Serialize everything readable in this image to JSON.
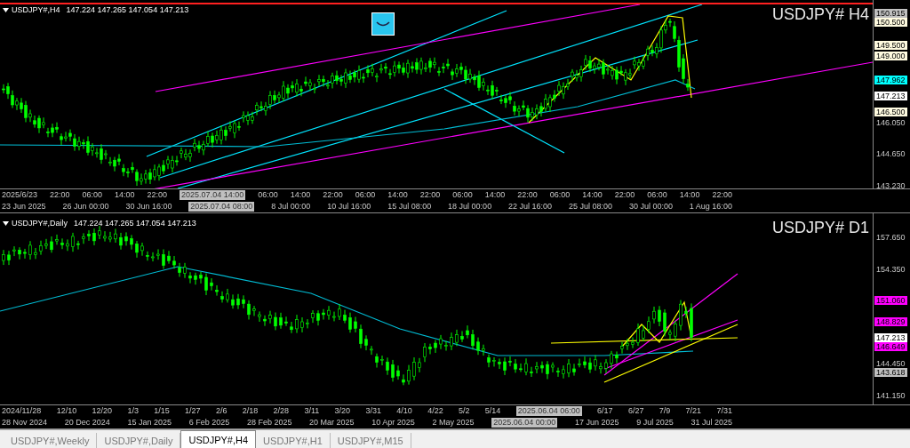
{
  "panes": [
    {
      "symbol": "USDJPY#,H4",
      "ohlc": "147.224 147.265 147.054 147.213",
      "title": "USDJPY# H4",
      "price_axis": [
        {
          "text": "150.915",
          "kind": "tag",
          "color": "#c0c0c0"
        },
        {
          "text": "150.500",
          "kind": "tag",
          "color": "#fffbe0"
        },
        {
          "text": "149.500",
          "kind": "tag",
          "color": "#fffbe0"
        },
        {
          "text": "149.000",
          "kind": "tag",
          "color": "#fffbe0"
        },
        {
          "text": "147.962",
          "kind": "tag",
          "color": "#00ffff"
        },
        {
          "text": "147.213",
          "kind": "tag",
          "color": "#ffffff"
        },
        {
          "text": "146.500",
          "kind": "tag",
          "color": "#fffbe0"
        },
        {
          "text": "146.050",
          "kind": "tick"
        },
        {
          "text": "144.650",
          "kind": "tick"
        },
        {
          "text": "143.230",
          "kind": "tick"
        }
      ],
      "time_row_1": [
        {
          "text": "2025/6/23",
          "kind": "tick"
        },
        {
          "text": "22:00",
          "kind": "tick"
        },
        {
          "text": "06:00",
          "kind": "tick"
        },
        {
          "text": "14:00",
          "kind": "tick"
        },
        {
          "text": "22:00",
          "kind": "tick"
        },
        {
          "text": "2025.07.04 14:00",
          "kind": "crosshair"
        },
        {
          "text": "06:00",
          "kind": "tick"
        },
        {
          "text": "14:00",
          "kind": "tick"
        },
        {
          "text": "22:00",
          "kind": "tick"
        },
        {
          "text": "06:00",
          "kind": "tick"
        },
        {
          "text": "14:00",
          "kind": "tick"
        },
        {
          "text": "22:00",
          "kind": "tick"
        },
        {
          "text": "06:00",
          "kind": "tick"
        },
        {
          "text": "14:00",
          "kind": "tick"
        },
        {
          "text": "22:00",
          "kind": "tick"
        },
        {
          "text": "06:00",
          "kind": "tick"
        },
        {
          "text": "14:00",
          "kind": "tick"
        },
        {
          "text": "22:00",
          "kind": "tick"
        },
        {
          "text": "06:00",
          "kind": "tick"
        },
        {
          "text": "14:00",
          "kind": "tick"
        },
        {
          "text": "22:00",
          "kind": "tick"
        }
      ],
      "time_row_2": [
        {
          "text": "23 Jun 2025",
          "kind": "tick"
        },
        {
          "text": "26 Jun 00:00",
          "kind": "tick"
        },
        {
          "text": "30 Jun 16:00",
          "kind": "tick"
        },
        {
          "text": "2025.07.04 08:00",
          "kind": "crosshair"
        },
        {
          "text": "8 Jul 00:00",
          "kind": "tick"
        },
        {
          "text": "10 Jul 16:00",
          "kind": "tick"
        },
        {
          "text": "15 Jul 08:00",
          "kind": "tick"
        },
        {
          "text": "18 Jul 00:00",
          "kind": "tick"
        },
        {
          "text": "22 Jul 16:00",
          "kind": "tick"
        },
        {
          "text": "25 Jul 08:00",
          "kind": "tick"
        },
        {
          "text": "30 Jul 00:00",
          "kind": "tick"
        },
        {
          "text": "1 Aug 16:00",
          "kind": "tick"
        }
      ]
    },
    {
      "symbol": "USDJPY#,Daily",
      "ohlc": "147.224 147.265 147.054 147.213",
      "title": "USDJPY# D1",
      "price_axis": [
        {
          "text": "157.650",
          "kind": "tick"
        },
        {
          "text": "154.350",
          "kind": "tick"
        },
        {
          "text": "151.060",
          "kind": "tag",
          "color": "#ff00ff"
        },
        {
          "text": "148.829",
          "kind": "tag",
          "color": "#ff00ff"
        },
        {
          "text": "147.213",
          "kind": "tag",
          "color": "#ffffff"
        },
        {
          "text": "146.649",
          "kind": "tag",
          "color": "#ff00ff"
        },
        {
          "text": "144.450",
          "kind": "tick"
        },
        {
          "text": "143.618",
          "kind": "tag",
          "color": "#c0c0c0"
        },
        {
          "text": "141.150",
          "kind": "tick"
        }
      ],
      "time_row_1": [
        {
          "text": "2024/11/28",
          "kind": "tick"
        },
        {
          "text": "12/10",
          "kind": "tick"
        },
        {
          "text": "12/20",
          "kind": "tick"
        },
        {
          "text": "1/3",
          "kind": "tick"
        },
        {
          "text": "1/15",
          "kind": "tick"
        },
        {
          "text": "1/27",
          "kind": "tick"
        },
        {
          "text": "2/6",
          "kind": "tick"
        },
        {
          "text": "2/18",
          "kind": "tick"
        },
        {
          "text": "2/28",
          "kind": "tick"
        },
        {
          "text": "3/11",
          "kind": "tick"
        },
        {
          "text": "3/20",
          "kind": "tick"
        },
        {
          "text": "3/31",
          "kind": "tick"
        },
        {
          "text": "4/10",
          "kind": "tick"
        },
        {
          "text": "4/22",
          "kind": "tick"
        },
        {
          "text": "5/2",
          "kind": "tick"
        },
        {
          "text": "5/14",
          "kind": "tick"
        },
        {
          "text": "2025.06.04 06:00",
          "kind": "crosshair"
        },
        {
          "text": "6/17",
          "kind": "tick"
        },
        {
          "text": "6/27",
          "kind": "tick"
        },
        {
          "text": "7/9",
          "kind": "tick"
        },
        {
          "text": "7/21",
          "kind": "tick"
        },
        {
          "text": "7/31",
          "kind": "tick"
        }
      ],
      "time_row_2": [
        {
          "text": "28 Nov 2024",
          "kind": "tick"
        },
        {
          "text": "20 Dec 2024",
          "kind": "tick"
        },
        {
          "text": "15 Jan 2025",
          "kind": "tick"
        },
        {
          "text": "6 Feb 2025",
          "kind": "tick"
        },
        {
          "text": "28 Feb 2025",
          "kind": "tick"
        },
        {
          "text": "20 Mar 2025",
          "kind": "tick"
        },
        {
          "text": "10 Apr 2025",
          "kind": "tick"
        },
        {
          "text": "2 May 2025",
          "kind": "tick"
        },
        {
          "text": "2025.06.04 00:00",
          "kind": "crosshair"
        },
        {
          "text": "17 Jun 2025",
          "kind": "tick"
        },
        {
          "text": "9 Jul 2025",
          "kind": "tick"
        },
        {
          "text": "31 Jul 2025",
          "kind": "tick"
        }
      ]
    }
  ],
  "tabs": [
    {
      "label": "USDJPY#,Weekly",
      "selected": false
    },
    {
      "label": "USDJPY#,Daily",
      "selected": false
    },
    {
      "label": "USDJPY#,H4",
      "selected": true
    },
    {
      "label": "USDJPY#,H1",
      "selected": false
    },
    {
      "label": "USDJPY#,M15",
      "selected": false
    }
  ]
}
